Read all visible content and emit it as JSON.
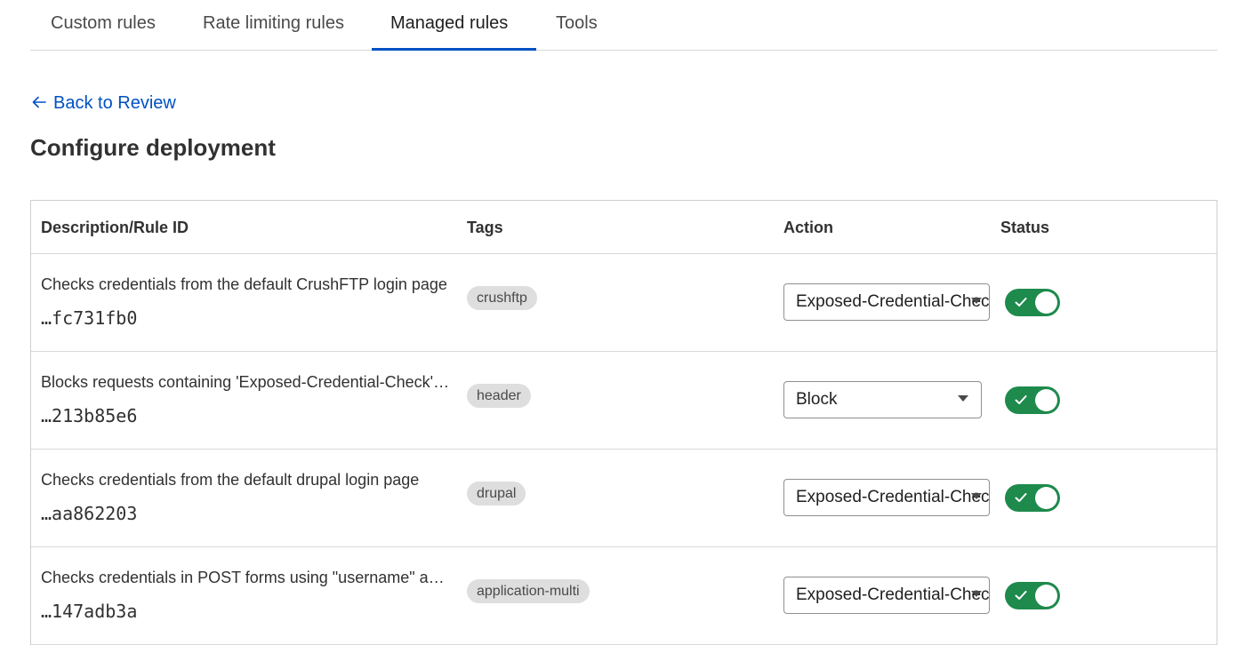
{
  "tabs": [
    {
      "label": "Custom rules"
    },
    {
      "label": "Rate limiting rules"
    },
    {
      "label": "Managed rules",
      "active": true
    },
    {
      "label": "Tools"
    }
  ],
  "back_link": {
    "label": "Back to Review",
    "icon": "arrow-left-icon"
  },
  "page_title": "Configure deployment",
  "table": {
    "headers": {
      "description": "Description/Rule ID",
      "tags": "Tags",
      "action": "Action",
      "status": "Status"
    },
    "rows": [
      {
        "description": "Checks credentials from the default CrushFTP login page",
        "rule_id": "…fc731fb0",
        "tag": "crushftp",
        "action": "Exposed-Credential-Check Header",
        "status_enabled": true
      },
      {
        "description": "Blocks requests containing 'Exposed-Credential-Check' header",
        "rule_id": "…213b85e6",
        "tag": "header",
        "action": "Block",
        "status_enabled": true
      },
      {
        "description": "Checks credentials from the default drupal login page",
        "rule_id": "…aa862203",
        "tag": "drupal",
        "action": "Exposed-Credential-Check Header",
        "status_enabled": true
      },
      {
        "description": "Checks credentials in POST forms using \"username\" and \"password\" fields",
        "rule_id": "…147adb3a",
        "tag": "application-multi",
        "action": "Exposed-Credential-Check Header",
        "status_enabled": true
      }
    ]
  },
  "colors": {
    "accent": "#0051c3",
    "toggle_on": "#1e8a4c",
    "tag_bg": "#dedede"
  }
}
